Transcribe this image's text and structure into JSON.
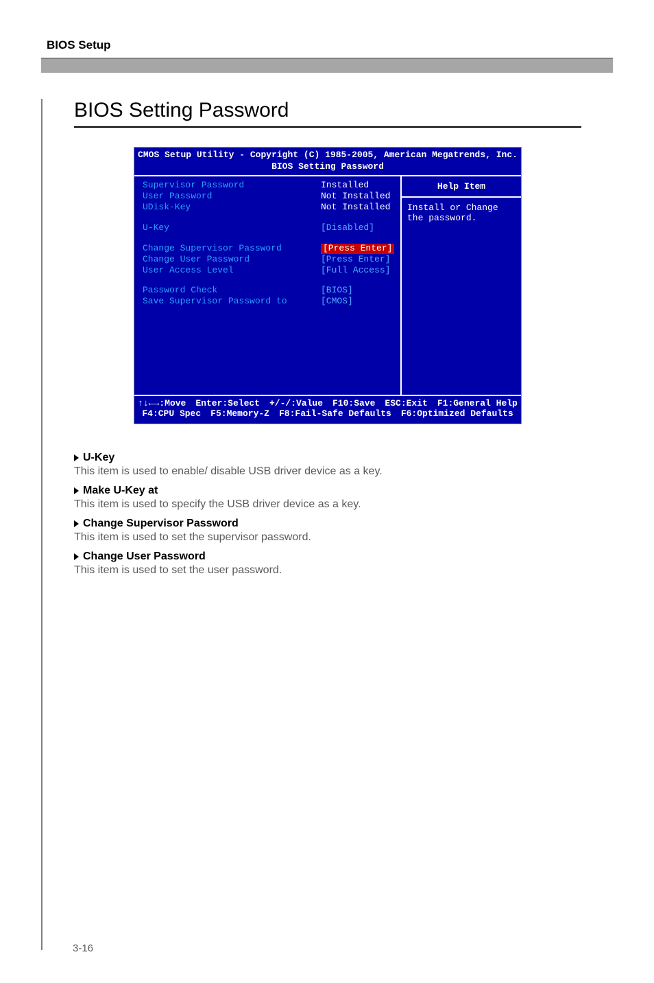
{
  "page": {
    "top_label": "BIOS Setup",
    "heading": "BIOS Setting Password",
    "page_number": "3-16"
  },
  "bios": {
    "title_line1": "CMOS Setup Utility - Copyright (C) 1985-2005, American Megatrends, Inc.",
    "title_line2": "BIOS Setting Password",
    "rows": [
      {
        "label": "Supervisor Password",
        "value": "Installed",
        "white": true
      },
      {
        "label": "User Password",
        "value": "Not Installed",
        "white": true
      },
      {
        "label": "UDisk-Key",
        "value": "Not Installed",
        "white": true
      }
    ],
    "rows2": [
      {
        "label": "U-Key",
        "value": "[Disabled]"
      }
    ],
    "rows3": [
      {
        "label": "Change Supervisor Password",
        "value": "[Press Enter]",
        "badge": true
      },
      {
        "label": "Change User Password",
        "value": "[Press Enter]"
      },
      {
        "label": "User Access Level",
        "value": "[Full Access]"
      }
    ],
    "rows4": [
      {
        "label": "Password Check",
        "value": "[BIOS]"
      },
      {
        "label": "Save Supervisor Password to",
        "value": "[CMOS]"
      }
    ],
    "help": {
      "title": "Help Item",
      "text": "Install or Change the password."
    },
    "footer1": [
      "↑↓←→:Move",
      "Enter:Select",
      "+/-/:Value",
      "F10:Save",
      "ESC:Exit",
      "F1:General Help"
    ],
    "footer2": [
      "F4:CPU Spec",
      "F5:Memory-Z",
      "F8:Fail-Safe Defaults",
      "F6:Optimized Defaults"
    ]
  },
  "desc": [
    {
      "head": "U-Key",
      "body": "This item is used to enable/ disable USB driver device as a key."
    },
    {
      "head": "Make U-Key at",
      "body": "This item is used to specify the USB driver device as a key."
    },
    {
      "head": "Change Supervisor Password",
      "body": "This item is used to set the supervisor password."
    },
    {
      "head": "Change User Password",
      "body": "This item is used to set the user password."
    }
  ]
}
